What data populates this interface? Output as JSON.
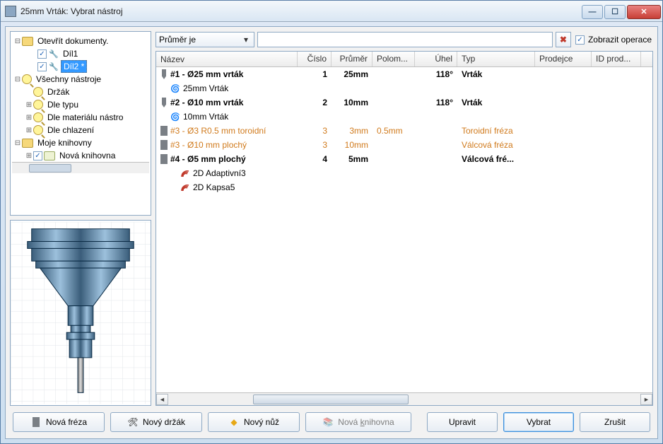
{
  "title": "25mm Vrták: Vybrat nástroj",
  "filter": {
    "combo": "Průměr je",
    "value": "",
    "show_ops_label": "Zobrazit operace",
    "show_ops_checked": true
  },
  "tree": {
    "n0": "Otevřít dokumenty.",
    "n0a": "Díl1",
    "n0b": "Díl2 *",
    "n1": "Všechny nástroje",
    "n1a": "Držák",
    "n1b": "Dle typu",
    "n1c": "Dle materiálu nástro",
    "n1d": "Dle chlazení",
    "n2": "Moje knihovny",
    "n2a": "Nová knihovna"
  },
  "grid": {
    "h_name": "Název",
    "h_num": "Číslo",
    "h_dia": "Průměr",
    "h_rad": "Polom...",
    "h_ang": "Úhel",
    "h_typ": "Typ",
    "h_ven": "Prodejce",
    "h_pid": "ID prod...",
    "rows": [
      {
        "kind": "tool",
        "bold": true,
        "name": "#1 - Ø25 mm vrták",
        "num": "1",
        "dia": "25mm",
        "rad": "",
        "ang": "118°",
        "typ": "Vrták",
        "icon": "drill"
      },
      {
        "kind": "child",
        "name": "25mm Vrták"
      },
      {
        "kind": "tool",
        "bold": true,
        "name": "#2 - Ø10 mm vrták",
        "num": "2",
        "dia": "10mm",
        "rad": "",
        "ang": "118°",
        "typ": "Vrták",
        "icon": "drill"
      },
      {
        "kind": "child",
        "name": "10mm Vrták"
      },
      {
        "kind": "tool",
        "orange": true,
        "name": "#3 - Ø3 R0.5 mm toroidní",
        "num": "3",
        "dia": "3mm",
        "rad": "0.5mm",
        "ang": "",
        "typ": "Toroidní fréza",
        "icon": "mill"
      },
      {
        "kind": "tool",
        "orange": true,
        "name": "#3 - Ø10 mm plochý",
        "num": "3",
        "dia": "10mm",
        "rad": "",
        "ang": "",
        "typ": "Válcová fréza",
        "icon": "mill"
      },
      {
        "kind": "tool",
        "bold": true,
        "name": "#4 - Ø5 mm plochý",
        "num": "4",
        "dia": "5mm",
        "rad": "",
        "ang": "",
        "typ": "Válcová fré...",
        "icon": "mill"
      },
      {
        "kind": "op",
        "name": "2D Adaptivní3"
      },
      {
        "kind": "op",
        "name": "2D Kapsa5"
      }
    ]
  },
  "buttons": {
    "new_mill": "Nová fréza",
    "new_holder": "Nový držák",
    "new_knife": "Nový nůž",
    "new_lib_pre": "Nová ",
    "new_lib_u": "k",
    "new_lib_post": "nihovna",
    "edit": "Upravit",
    "select": "Vybrat",
    "cancel": "Zrušit"
  }
}
